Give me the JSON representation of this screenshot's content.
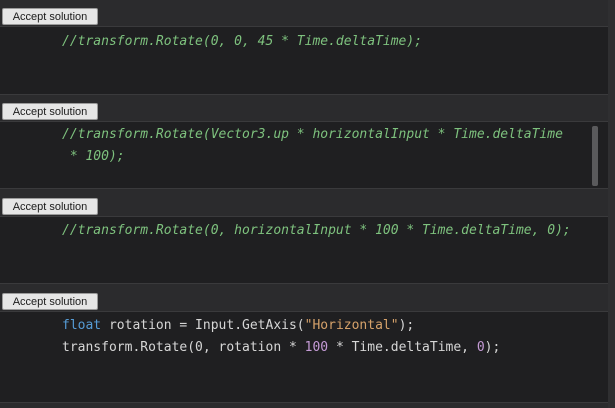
{
  "blocks": [
    {
      "button_label": "Accept solution",
      "lines": [
        "//transform.Rotate(0, 0, 45 * Time.deltaTime);"
      ]
    },
    {
      "button_label": "Accept solution",
      "lines": [
        "//transform.Rotate(Vector3.up * horizontalInput * Time.deltaTime",
        " * 100);"
      ]
    },
    {
      "button_label": "Accept solution",
      "lines": [
        "//transform.Rotate(0, horizontalInput * 100 * Time.deltaTime, 0);"
      ]
    },
    {
      "button_label": "Accept solution",
      "line1": {
        "keyword": "float",
        "mid": " rotation = Input.GetAxis(",
        "string": "\"Horizontal\"",
        "end": ");"
      },
      "line2": {
        "start": "transform.Rotate(0, rotation * ",
        "number1": "100",
        "mid": " * Time.deltaTime, ",
        "number2": "0",
        "end": ");"
      }
    }
  ]
}
